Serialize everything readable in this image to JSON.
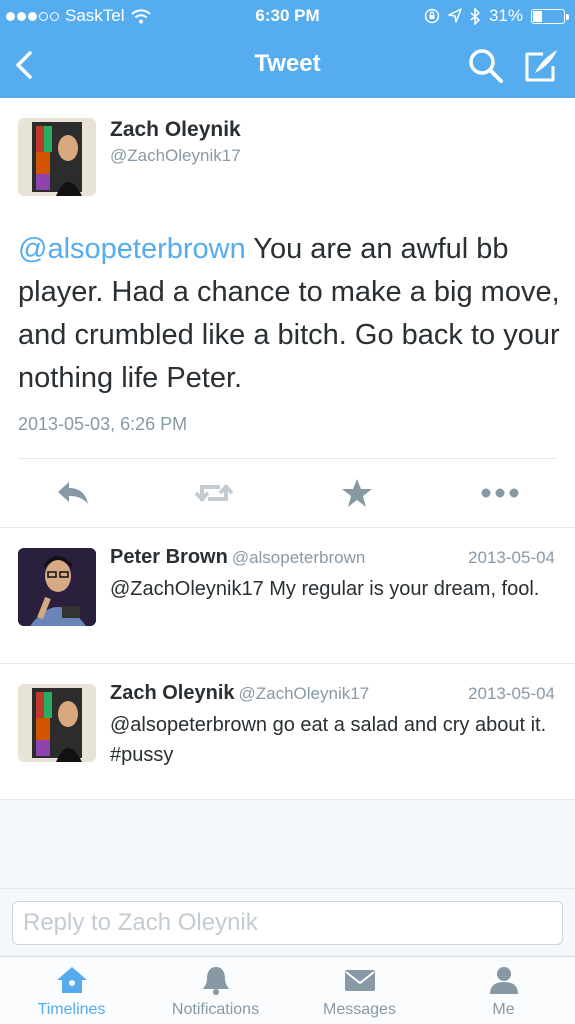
{
  "status_bar": {
    "carrier": "SaskTel",
    "time": "6:30 PM",
    "battery": "31%",
    "battery_level": 0.31
  },
  "nav": {
    "title": "Tweet"
  },
  "main_tweet": {
    "name": "Zach Oleynik",
    "handle": "@ZachOleynik17",
    "mention": "@alsopeterbrown",
    "text": " You are an awful bb player. Had a chance to make a big move, and crumbled like a bitch. Go back to your nothing life Peter.",
    "timestamp": "2013-05-03, 6:26 PM"
  },
  "replies": [
    {
      "name": "Peter Brown",
      "handle": "@alsopeterbrown",
      "date": "2013-05-04",
      "text": "@ZachOleynik17 My regular is your dream, fool."
    },
    {
      "name": "Zach Oleynik",
      "handle": "@ZachOleynik17",
      "date": "2013-05-04",
      "text": "@alsopeterbrown go eat a salad and cry about it. #pussy"
    }
  ],
  "reply_box": {
    "placeholder": "Reply to Zach Oleynik"
  },
  "tabs": [
    {
      "label": "Timelines",
      "icon": "home-icon"
    },
    {
      "label": "Notifications",
      "icon": "bell-icon"
    },
    {
      "label": "Messages",
      "icon": "envelope-icon"
    },
    {
      "label": "Me",
      "icon": "person-icon"
    }
  ],
  "colors": {
    "accent": "#55acee",
    "text": "#292f33",
    "muted": "#8899a6"
  }
}
